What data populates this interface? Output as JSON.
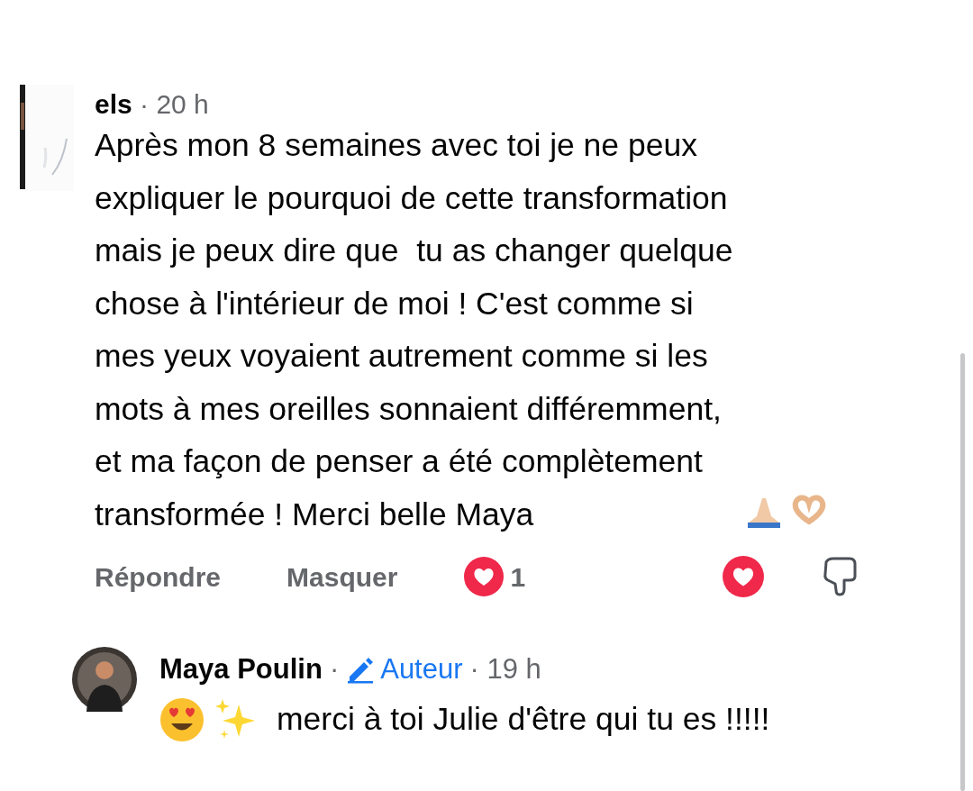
{
  "comment": {
    "author": "els",
    "time": "· 20 h",
    "text": "Après mon 8 semaines avec toi je ne peux\nexpliquer le pourquoi de cette transformation\nmais je peux dire que  tu as changer quelque\nchose à l'intérieur de moi ! C'est comme si\nmes yeux voyaient autrement comme si les\nmots à mes oreilles sonnaient différemment,\net ma façon de penser a été complètement\ntransformée ! Merci belle Maya",
    "actions": [
      {
        "label": "Répondre"
      },
      {
        "label": "Masquer"
      }
    ],
    "reaction_count": "1"
  },
  "reply": {
    "author": "Maya Poulin",
    "separator": "·",
    "badge": "Auteur",
    "time": "· 19 h",
    "text": "merci à toi Julie d'être qui tu es !!!!!"
  }
}
